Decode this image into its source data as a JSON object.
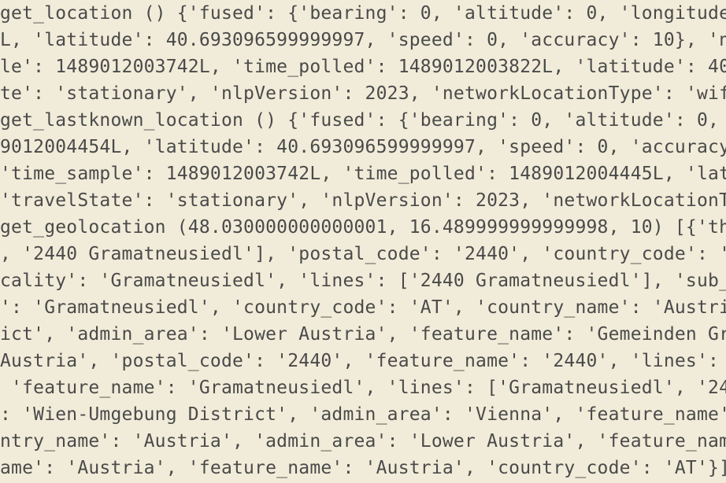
{
  "terminal": {
    "lines": [
      "get_location () {'fused': {'bearing': 0, 'altitude': 0, 'longitude",
      "L, 'latitude': 40.693096599999997, 'speed': 0, 'accuracy': 10}, 'n",
      "le': 1489012003742L, 'time_polled': 1489012003822L, 'latitude': 40",
      "te': 'stationary', 'nlpVersion': 2023, 'networkLocationType': 'wif",
      "get_lastknown_location () {'fused': {'bearing': 0, 'altitude': 0,",
      "9012004454L, 'latitude': 40.693096599999997, 'speed': 0, 'accuracy",
      "'time_sample': 1489012003742L, 'time_polled': 1489012004445L, 'lat",
      "'travelState': 'stationary', 'nlpVersion': 2023, 'networkLocationT",
      "get_geolocation (48.030000000000001, 16.489999999999998, 10) [{'th",
      ", '2440 Gramatneusiedl'], 'postal_code': '2440', 'country_code': '",
      "cality': 'Gramatneusiedl', 'lines': ['2440 Gramatneusiedl'], 'sub_",
      "': 'Gramatneusiedl', 'country_code': 'AT', 'country_name': 'Austri",
      "ict', 'admin_area': 'Lower Austria', 'feature_name': 'Gemeinden Gr",
      "Austria', 'postal_code': '2440', 'feature_name': '2440', 'lines': ",
      " 'feature_name': 'Gramatneusiedl', 'lines': ['Gramatneusiedl', '24",
      ": 'Wien-Umgebung District', 'admin_area': 'Vienna', 'feature_name'",
      "ntry_name': 'Austria', 'admin_area': 'Lower Austria', 'feature_nam",
      "ame': 'Austria', 'feature_name': 'Austria', 'country_code': 'AT'}]"
    ]
  }
}
